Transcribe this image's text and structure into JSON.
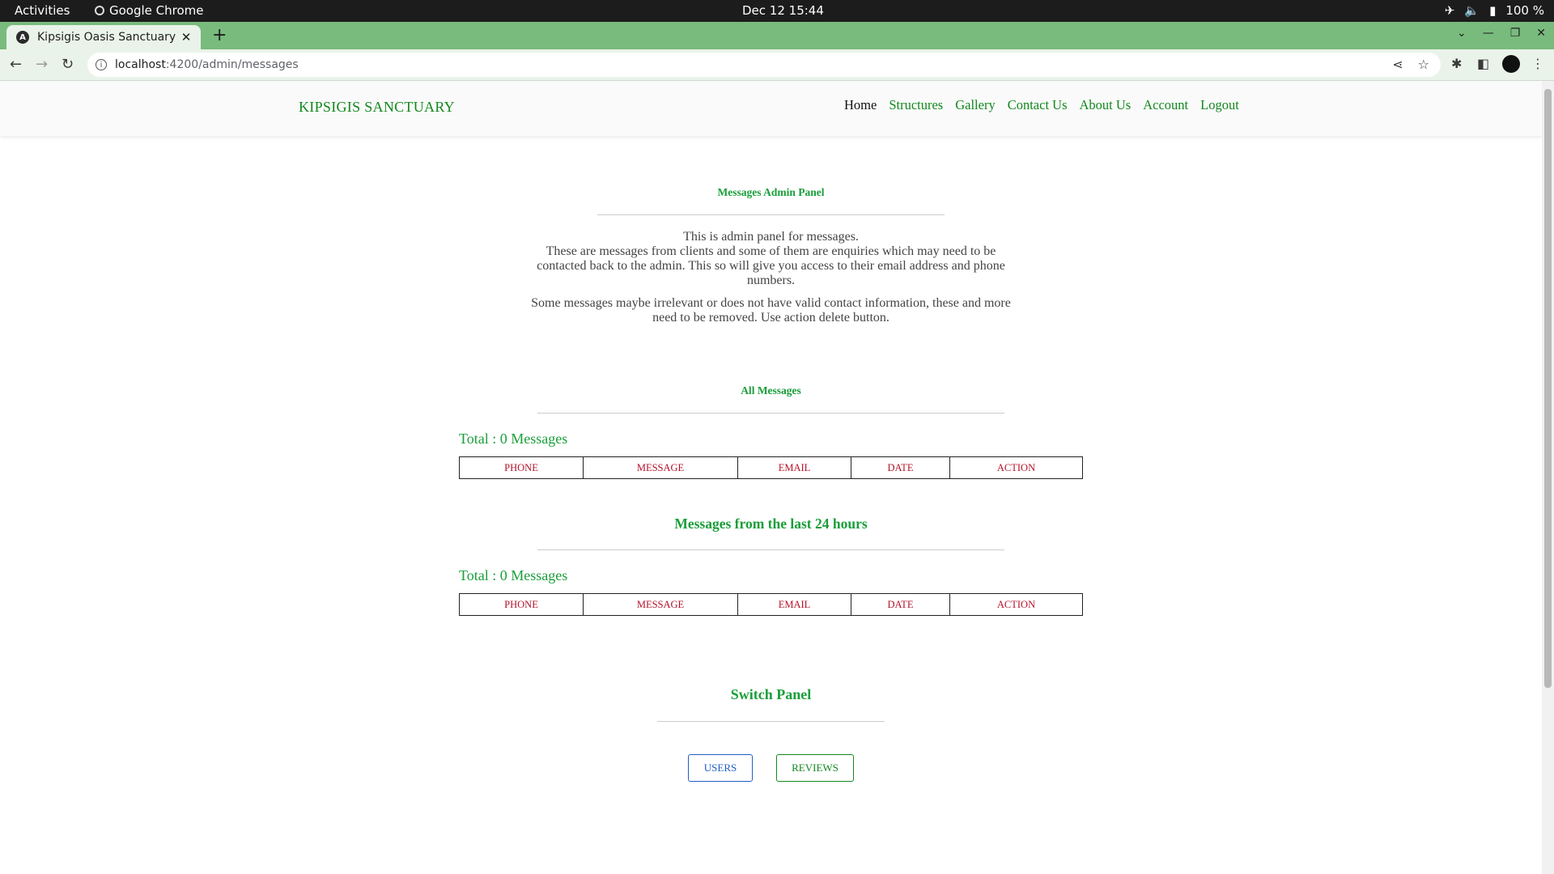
{
  "os": {
    "activities": "Activities",
    "app_name": "Google Chrome",
    "clock": "Dec 12  15:44",
    "battery": "100 %"
  },
  "browser": {
    "tab_title": "Kipsigis Oasis Sanctuary",
    "url_host": "localhost",
    "url_path": ":4200/admin/messages",
    "theme_color": "#79bb7d"
  },
  "site": {
    "brand": "KIPSIGIS SANCTUARY",
    "nav": [
      "Home",
      "Structures",
      "Gallery",
      "Contact Us",
      "About Us",
      "Account",
      "Logout"
    ],
    "accent_color": "#13881f"
  },
  "panel": {
    "title": "Messages Admin Panel",
    "intro_1_line1": "This is admin panel for messages.",
    "intro_1_line2": "These are messages from clients and some of them are enquiries which may need to be contacted back to the admin. This so will give you access to their email address and phone numbers.",
    "intro_2": "Some messages maybe irrelevant or does not have valid contact information, these and more need to be removed. Use action delete button."
  },
  "all_messages": {
    "heading": "All Messages",
    "total": "Total : 0 Messages",
    "columns": [
      "PHONE",
      "MESSAGE",
      "EMAIL",
      "DATE",
      "ACTION"
    ]
  },
  "recent_messages": {
    "heading": "Messages from the last 24 hours",
    "total": "Total : 0 Messages",
    "columns": [
      "PHONE",
      "MESSAGE",
      "EMAIL",
      "DATE",
      "ACTION"
    ]
  },
  "switch_panel": {
    "heading": "Switch Panel",
    "users_label": "USERS",
    "reviews_label": "REVIEWS"
  }
}
